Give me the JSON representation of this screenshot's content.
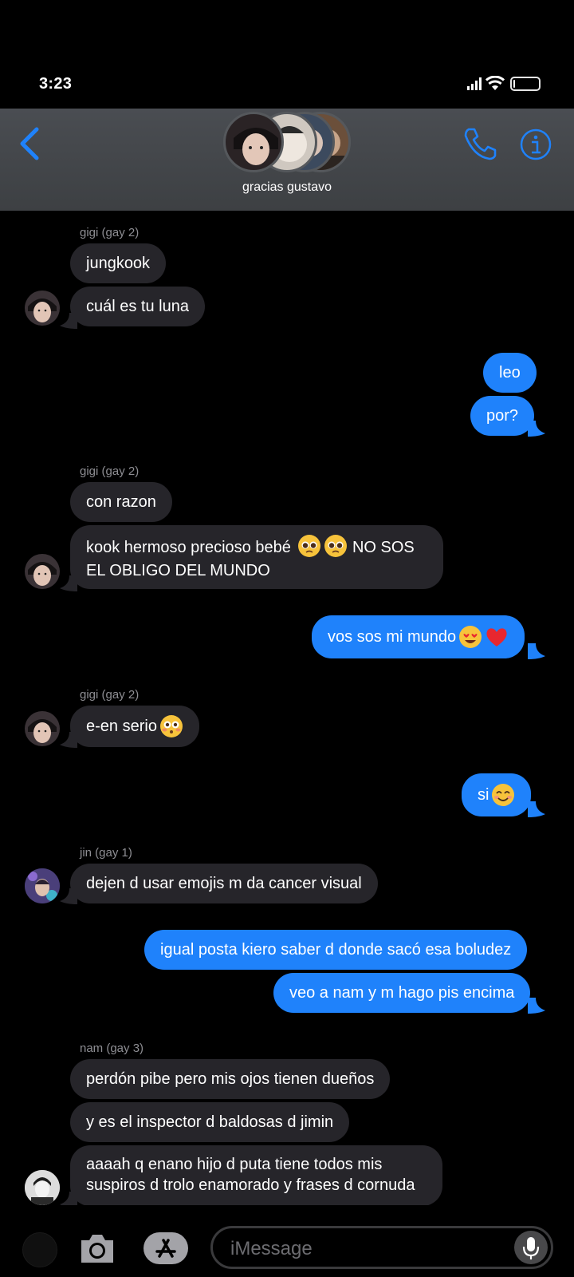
{
  "status_bar": {
    "time": "3:23",
    "battery_level": 0.08
  },
  "header": {
    "group_name": "gracias gustavo",
    "accent": "#1f82fb"
  },
  "messages": [
    {
      "sender": "gigi (gay 2)",
      "bubbles": [
        "jungkook",
        "cuál es tu luna"
      ]
    },
    {
      "out": [
        "leo",
        "por?"
      ]
    },
    {
      "sender": "gigi (gay 2)",
      "bubbles": [
        "con razon",
        "kook hermoso precioso bebé",
        "NO SOS",
        "EL OBLIGO DEL MUNDO"
      ]
    },
    {
      "out": [
        "vos sos mi mundo"
      ]
    },
    {
      "sender": "gigi (gay 2)",
      "bubbles": [
        "e-en serio"
      ]
    },
    {
      "out": [
        "si"
      ]
    },
    {
      "sender": "jin (gay 1)",
      "bubbles": [
        "dejen d usar emojis m da cancer visual"
      ]
    },
    {
      "out": [
        "igual posta kiero saber d donde sacó esa boludez",
        "veo a nam y m hago pis encima"
      ]
    },
    {
      "sender": "nam (gay 3)",
      "bubbles": [
        "perdón pibe pero mis ojos tienen dueños",
        "y es el inspector d baldosas d jimin",
        "aaaah q enano hijo d puta tiene todos mis",
        "suspiros d trolo enamorado y frases d cornuda"
      ]
    }
  ],
  "emoji_names": [
    "pleading-face-emoji",
    "heart-eyes-emoji",
    "red-heart-emoji",
    "flushed-face-emoji",
    "smiling-face-emoji"
  ],
  "composer": {
    "placeholder": "iMessage"
  },
  "colors": {
    "incoming_bubble": "#26252a",
    "outgoing_bubble": "#1f82fb",
    "background": "#000000"
  }
}
